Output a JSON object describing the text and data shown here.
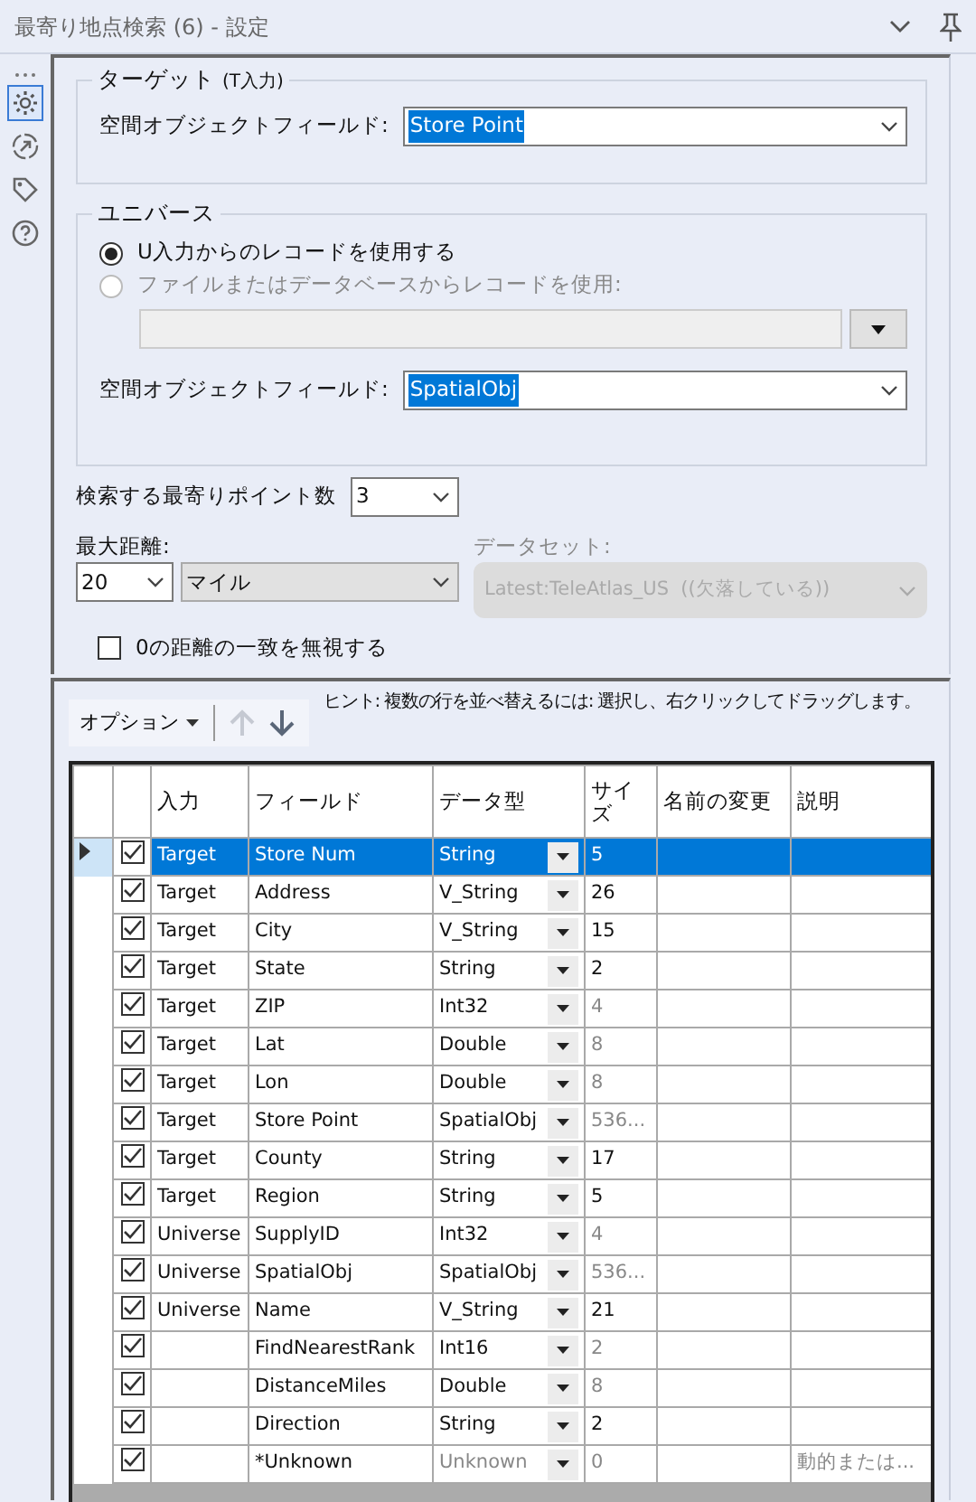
{
  "window": {
    "title": "最寄り地点検索 (6) - 設定"
  },
  "sidebar": {
    "items": [
      {
        "kind": "gear",
        "selected": true
      },
      {
        "kind": "arrow",
        "selected": false
      },
      {
        "kind": "tag",
        "selected": false
      },
      {
        "kind": "help",
        "selected": false
      }
    ]
  },
  "target": {
    "legend": "ターゲット",
    "legend_note": "(T入力)",
    "field_label": "空間オブジェクトフィールド:",
    "field_value": "Store Point"
  },
  "universe": {
    "legend": "ユニバース",
    "options": [
      {
        "label": "U入力からのレコードを使用する",
        "selected": true
      },
      {
        "label": "ファイルまたはデータベースからレコードを使用:",
        "selected": false
      }
    ],
    "field_label": "空間オブジェクトフィールド:",
    "field_value": "SpatialObj"
  },
  "nearest_count": {
    "label": "検索する最寄りポイント数",
    "value": "3"
  },
  "max_distance": {
    "label": "最大距離:",
    "value": "20",
    "unit": "マイル"
  },
  "dataset": {
    "label": "データセット:",
    "value": "Latest:TeleAtlas_US  ((欠落している))",
    "disabled": true
  },
  "ignore_zero": {
    "label": "0の距離の一致を無視する",
    "checked": false
  },
  "toolbar": {
    "options_label": "オプション",
    "up_disabled": true,
    "hint": "ヒント: 複数の行を並べ替えるには: 選択し、右クリックしてドラッグします。"
  },
  "table": {
    "columns": [
      "入力",
      "フィールド",
      "データ型",
      "サイズ",
      "名前の変更",
      "説明"
    ],
    "rows": [
      {
        "selected": true,
        "checked": true,
        "input": "Target",
        "field": "Store Num",
        "type": "String",
        "size": "5",
        "size_dim": false
      },
      {
        "selected": false,
        "checked": true,
        "input": "Target",
        "field": "Address",
        "type": "V_String",
        "size": "26",
        "size_dim": false
      },
      {
        "selected": false,
        "checked": true,
        "input": "Target",
        "field": "City",
        "type": "V_String",
        "size": "15",
        "size_dim": false
      },
      {
        "selected": false,
        "checked": true,
        "input": "Target",
        "field": "State",
        "type": "String",
        "size": "2",
        "size_dim": false
      },
      {
        "selected": false,
        "checked": true,
        "input": "Target",
        "field": "ZIP",
        "type": "Int32",
        "size": "4",
        "size_dim": true
      },
      {
        "selected": false,
        "checked": true,
        "input": "Target",
        "field": "Lat",
        "type": "Double",
        "size": "8",
        "size_dim": true
      },
      {
        "selected": false,
        "checked": true,
        "input": "Target",
        "field": "Lon",
        "type": "Double",
        "size": "8",
        "size_dim": true
      },
      {
        "selected": false,
        "checked": true,
        "input": "Target",
        "field": "Store Point",
        "type": "SpatialObj",
        "size": "536...",
        "size_dim": true
      },
      {
        "selected": false,
        "checked": true,
        "input": "Target",
        "field": "County",
        "type": "String",
        "size": "17",
        "size_dim": false
      },
      {
        "selected": false,
        "checked": true,
        "input": "Target",
        "field": "Region",
        "type": "String",
        "size": "5",
        "size_dim": false
      },
      {
        "selected": false,
        "checked": true,
        "input": "Universe",
        "field": "SupplyID",
        "type": "Int32",
        "size": "4",
        "size_dim": true
      },
      {
        "selected": false,
        "checked": true,
        "input": "Universe",
        "field": "SpatialObj",
        "type": "SpatialObj",
        "size": "536...",
        "size_dim": true
      },
      {
        "selected": false,
        "checked": true,
        "input": "Universe",
        "field": "Name",
        "type": "V_String",
        "size": "21",
        "size_dim": false
      },
      {
        "selected": false,
        "checked": true,
        "field": "FindNearestRank",
        "type": "Int16",
        "size": "2",
        "size_dim": true
      },
      {
        "selected": false,
        "checked": true,
        "field": "DistanceMiles",
        "type": "Double",
        "size": "8",
        "size_dim": true
      },
      {
        "selected": false,
        "checked": true,
        "field": "Direction",
        "type": "String",
        "size": "2",
        "size_dim": false
      },
      {
        "selected": false,
        "checked": true,
        "field": "*Unknown",
        "type": "Unknown",
        "type_dim": true,
        "size": "0",
        "size_dim": true,
        "description": "動的または..."
      }
    ]
  }
}
